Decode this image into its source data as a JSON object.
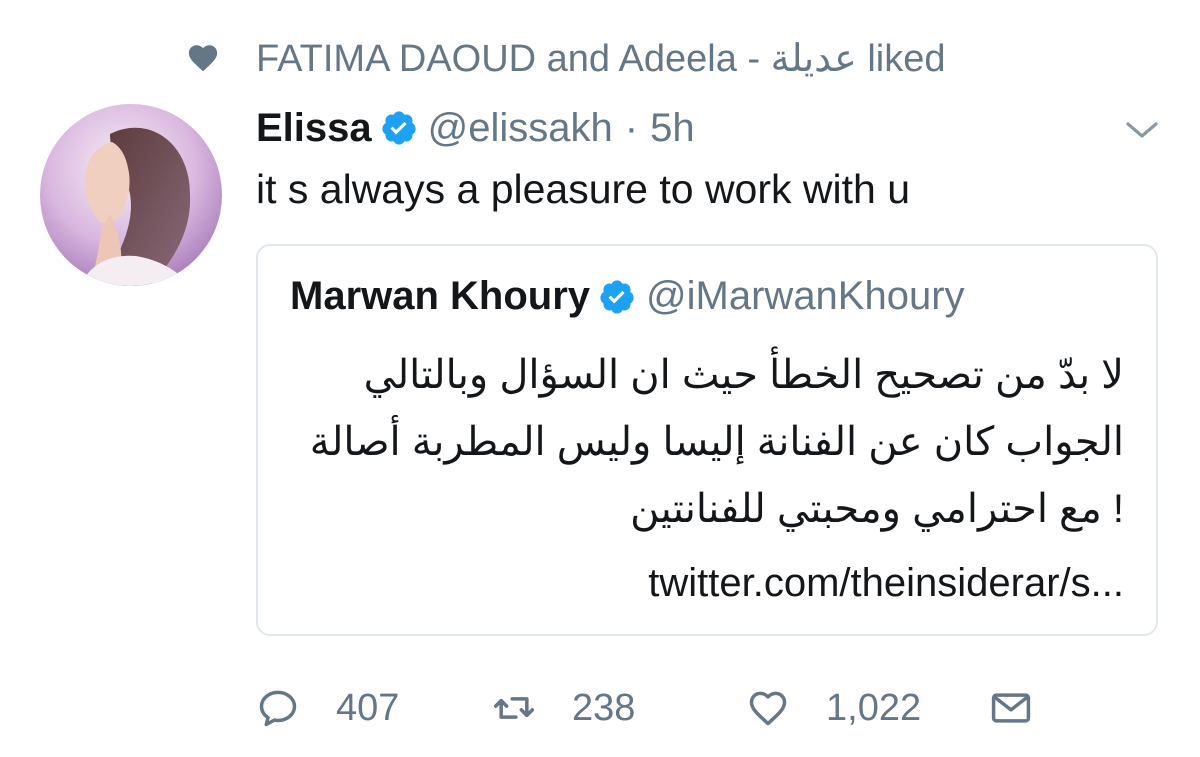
{
  "social_context": {
    "text": "FATIMA DAOUD and Adeela - عديلة liked",
    "icon": "heart-filled-icon"
  },
  "tweet": {
    "author_name": "Elissa",
    "author_handle": "@elissakh",
    "separator": "·",
    "time": "5h",
    "verified_icon": "verified-badge-icon",
    "text": "it s always a pleasure to work with u",
    "caret_icon": "chevron-down-icon"
  },
  "quoted_tweet": {
    "author_name": "Marwan Khoury",
    "author_handle": "@iMarwanKhoury",
    "text": "لا بدّ من تصحيح الخطأ حيث ان السؤال وبالتالي الجواب كان عن الفنانة إليسا وليس المطربة أصالة ! مع احترامي ومحبتي للفنانتين",
    "link": "twitter.com/theinsiderar/s..."
  },
  "actions": {
    "reply_count": "407",
    "retweet_count": "238",
    "like_count": "1,022",
    "reply_icon": "reply-icon",
    "retweet_icon": "retweet-icon",
    "like_icon": "heart-icon",
    "dm_icon": "envelope-icon"
  },
  "colors": {
    "text_primary": "#14171a",
    "text_secondary": "#657786",
    "verified": "#1da1f2",
    "border": "#e1e8ed"
  }
}
